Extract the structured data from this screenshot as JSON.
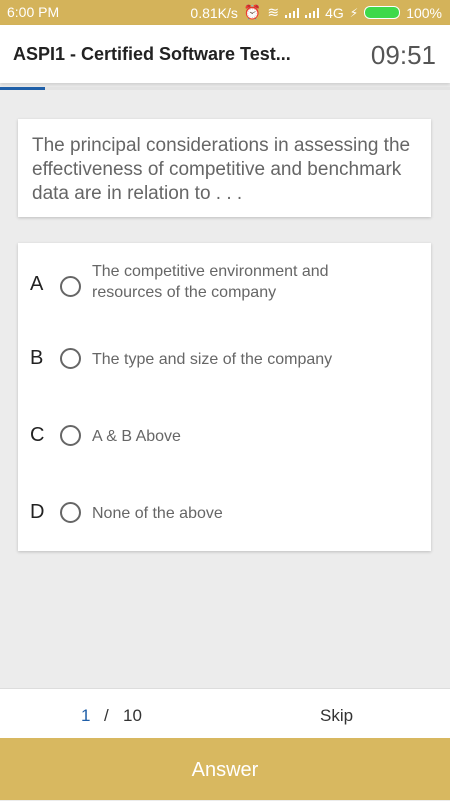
{
  "status_bar": {
    "time": "6:00 PM",
    "speed": "0.81K/s",
    "network": "4G",
    "battery": "100%"
  },
  "header": {
    "title": "ASPI1 - Certified Software Test...",
    "timer": "09:51"
  },
  "progress": {
    "fraction": 0.1
  },
  "question": {
    "text": "The principal considerations in assessing the effectiveness of competitive and benchmark data are in relation to . . ."
  },
  "options": [
    {
      "letter": "A",
      "text": "The competitive environment and resources of the company"
    },
    {
      "letter": "B",
      "text": "The type and size of the company"
    },
    {
      "letter": "C",
      "text": "A & B Above"
    },
    {
      "letter": "D",
      "text": "None of the above"
    }
  ],
  "footer": {
    "current_page": "1",
    "separator": "/",
    "total_pages": "10",
    "skip_label": "Skip",
    "answer_label": "Answer"
  },
  "colors": {
    "status_bar": "#d4b35a",
    "accent": "#1f5fa8",
    "answer_button": "#d8b860"
  }
}
